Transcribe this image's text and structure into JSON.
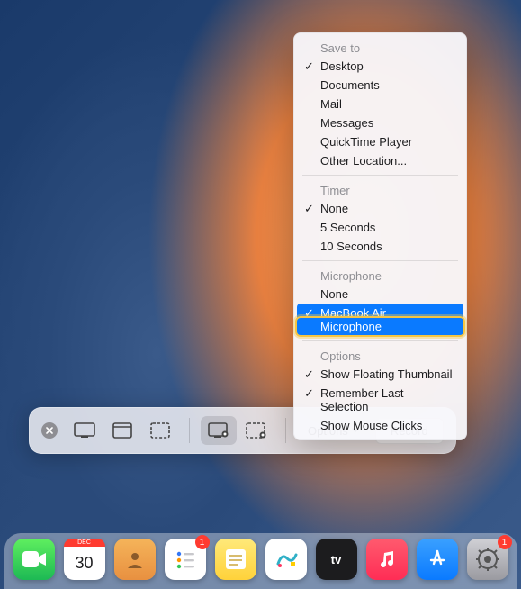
{
  "menu": {
    "save_to": {
      "label": "Save to",
      "items": [
        {
          "label": "Desktop",
          "checked": true
        },
        {
          "label": "Documents",
          "checked": false
        },
        {
          "label": "Mail",
          "checked": false
        },
        {
          "label": "Messages",
          "checked": false
        },
        {
          "label": "QuickTime Player",
          "checked": false
        },
        {
          "label": "Other Location...",
          "checked": false
        }
      ]
    },
    "timer": {
      "label": "Timer",
      "items": [
        {
          "label": "None",
          "checked": true
        },
        {
          "label": "5 Seconds",
          "checked": false
        },
        {
          "label": "10 Seconds",
          "checked": false
        }
      ]
    },
    "microphone": {
      "label": "Microphone",
      "items": [
        {
          "label": "None",
          "checked": false
        },
        {
          "label": "MacBook Air Microphone",
          "checked": true,
          "highlighted": true
        }
      ]
    },
    "options": {
      "label": "Options",
      "items": [
        {
          "label": "Show Floating Thumbnail",
          "checked": true
        },
        {
          "label": "Remember Last Selection",
          "checked": true
        },
        {
          "label": "Show Mouse Clicks",
          "checked": false
        }
      ]
    }
  },
  "toolbar": {
    "options_label": "Options",
    "record_label": "Record"
  },
  "dock": {
    "calendar": {
      "month": "DEC",
      "day": "30"
    },
    "reminders_badge": "1",
    "settings_badge": "1"
  },
  "colors": {
    "highlight": "#0a7aff",
    "ring": "#f5c542"
  }
}
